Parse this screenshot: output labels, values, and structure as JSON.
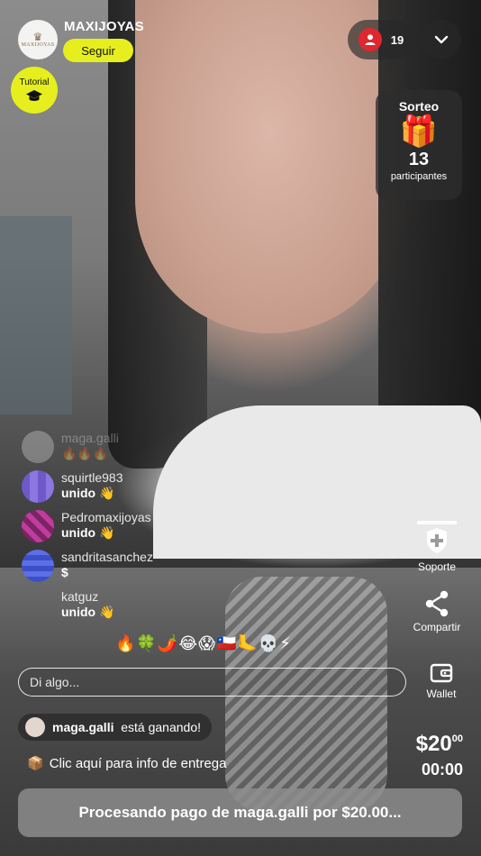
{
  "shop": {
    "name": "MAXIJOYAS",
    "logo_text": "MAXIJOYAS",
    "follow_label": "Seguir",
    "tutorial_label": "Tutorial"
  },
  "viewers": {
    "count": "19"
  },
  "raffle": {
    "title": "Sorteo",
    "count": "13",
    "participants_label": "participantes"
  },
  "chat": {
    "messages": [
      {
        "user": "maga.galli",
        "text": "🔥🔥🔥",
        "faded": true
      },
      {
        "user": "squirtle983",
        "text": "unido 👋"
      },
      {
        "user": "Pedromaxijoyas",
        "text": "unido 👋"
      },
      {
        "user": "sandritasanchez",
        "text": "$"
      },
      {
        "user": "katguz",
        "text": "unido 👋"
      }
    ]
  },
  "reactions": "🔥🍀🌶️😂😱🇨🇱🦶💀⚡",
  "side_actions": {
    "support_label": "Soporte",
    "share_label": "Compartir",
    "wallet_label": "Wallet"
  },
  "comment": {
    "placeholder": "Di algo..."
  },
  "winner": {
    "user": "maga.galli",
    "text": "está ganando!"
  },
  "delivery": {
    "text": "Clic aquí para info de entrega"
  },
  "auction": {
    "price_main": "$20",
    "price_cents": "00",
    "timer": "00:00"
  },
  "status_button": {
    "label": "Procesando pago de maga.galli por $20.00..."
  },
  "colors": {
    "accent": "#e6ef1d",
    "live_red": "#e0262e"
  }
}
